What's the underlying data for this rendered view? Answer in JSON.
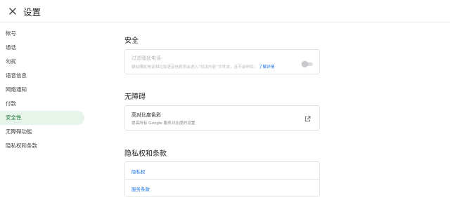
{
  "header": {
    "title": "设置"
  },
  "sidebar": {
    "items": [
      {
        "label": "帐号"
      },
      {
        "label": "通话"
      },
      {
        "label": "勿扰"
      },
      {
        "label": "语音信息"
      },
      {
        "label": "网络通知"
      },
      {
        "label": "付款"
      },
      {
        "label": "安全性",
        "active": true
      },
      {
        "label": "无障碍功能"
      },
      {
        "label": "隐私权和条款"
      }
    ]
  },
  "security": {
    "title": "安全",
    "spam": {
      "label": "过滤骚扰电话",
      "description": "疑似骚扰电话和垃圾语音信息将会进入“垃圾内容”文件夹，且不会响铃。",
      "learn_more": "了解详情",
      "enabled": false
    }
  },
  "accessibility": {
    "title": "无障碍",
    "high_contrast": {
      "label": "高对比度色彩",
      "description": "提高所有 Google 服务对比度的设置"
    }
  },
  "privacy": {
    "title": "隐私权和条款",
    "links": [
      {
        "label": "隐私权"
      },
      {
        "label": "服务条款"
      }
    ]
  },
  "colors": {
    "accent": "#1a73e8",
    "active_nav_bg": "#e6f4ea",
    "active_nav_text": "#137333",
    "border": "#e3e3e3"
  },
  "icons": {
    "close": "close-icon",
    "external": "open-in-new-icon"
  }
}
